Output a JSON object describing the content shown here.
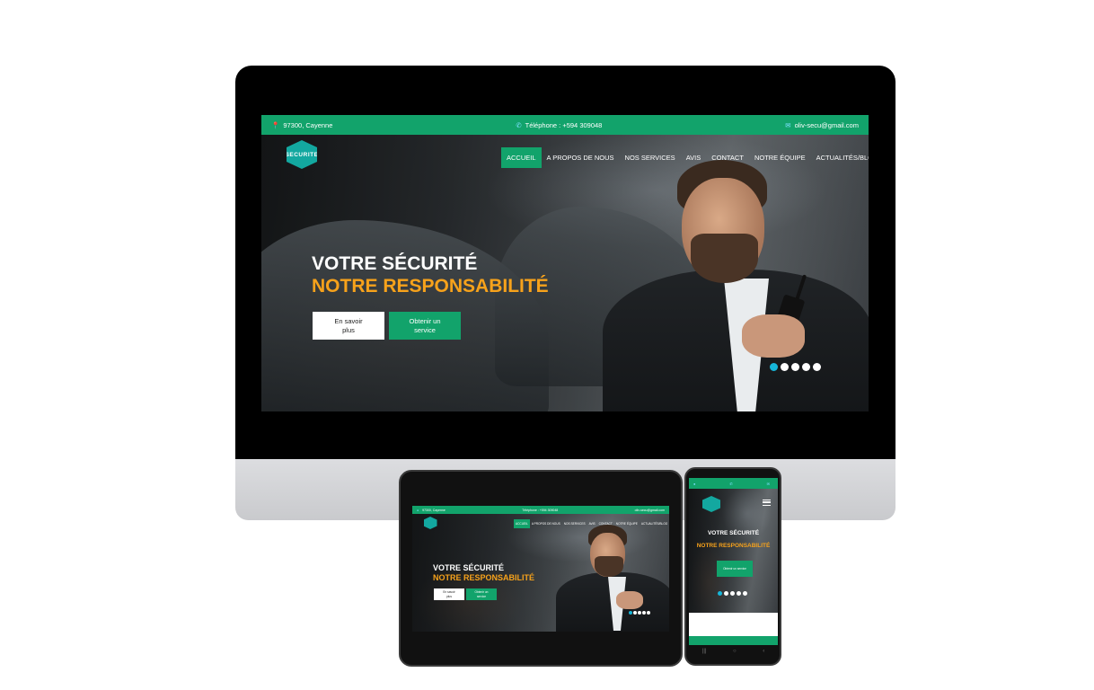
{
  "site": {
    "address": "97300, Cayenne",
    "phone": "Téléphone : +594 309048",
    "email": "oliv-secu@gmail.com",
    "logo_text": "SECURITE",
    "logo_sub": "SECURITE",
    "nav": [
      {
        "label": "ACCUEIL",
        "active": true
      },
      {
        "label": "A PROPOS DE NOUS",
        "active": false
      },
      {
        "label": "NOS SERVICES",
        "active": false
      },
      {
        "label": "AVIS",
        "active": false
      },
      {
        "label": "CONTACT",
        "active": false
      },
      {
        "label": "NOTRE ÉQUIPE",
        "active": false
      },
      {
        "label": "ACTUALITÉS/BLOG",
        "active": false
      }
    ],
    "hero_title": "VOTRE SÉCURITÉ",
    "hero_subtitle": "NOTRE RESPONSABILITÉ",
    "btn_more": "En savoir plus",
    "btn_service": "Obtenir un service",
    "slides": 5,
    "active_slide": 1
  },
  "phone": {
    "menu_icon": "hamburger-icon",
    "nav_back": "‹",
    "nav_home": "○",
    "nav_recent": "|||"
  },
  "colors": {
    "brand_green": "#12a36b",
    "accent_orange": "#f7a21b",
    "dot_active": "#16b6d9"
  }
}
